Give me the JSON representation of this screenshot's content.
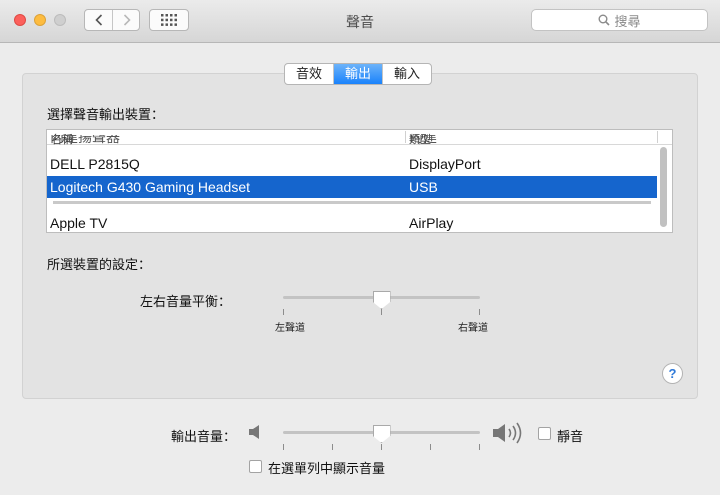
{
  "window": {
    "title": "聲音"
  },
  "search": {
    "placeholder": "搜尋"
  },
  "tabs": [
    {
      "label": "音效"
    },
    {
      "label": "輸出",
      "active": true
    },
    {
      "label": "輸入"
    }
  ],
  "output": {
    "devices_label": "選擇聲音輸出裝置：",
    "columns": {
      "name": "名稱",
      "type": "類型"
    },
    "devices": [
      {
        "name": "內建揚聲器",
        "type": "內建"
      },
      {
        "name": "DELL P2815Q",
        "type": "DisplayPort"
      },
      {
        "name": "Logitech G430 Gaming Headset",
        "type": "USB",
        "selected": true
      },
      {
        "name": "Apple TV",
        "type": "AirPlay"
      }
    ],
    "selected_settings_label": "所選裝置的設定：",
    "balance": {
      "label": "左右音量平衡：",
      "left_label": "左聲道",
      "right_label": "右聲道",
      "value": 0.5
    }
  },
  "volume": {
    "label": "輸出音量：",
    "value": 0.5,
    "mute_label": "靜音",
    "muted": false
  },
  "menu_bar_volume": {
    "label": "在選單列中顯示音量",
    "checked": false
  },
  "help": {
    "label": "?"
  },
  "colors": {
    "accent": "#1a82fb",
    "selection": "#1565cd",
    "panel": "#e3e3e3",
    "window": "#ececec"
  }
}
